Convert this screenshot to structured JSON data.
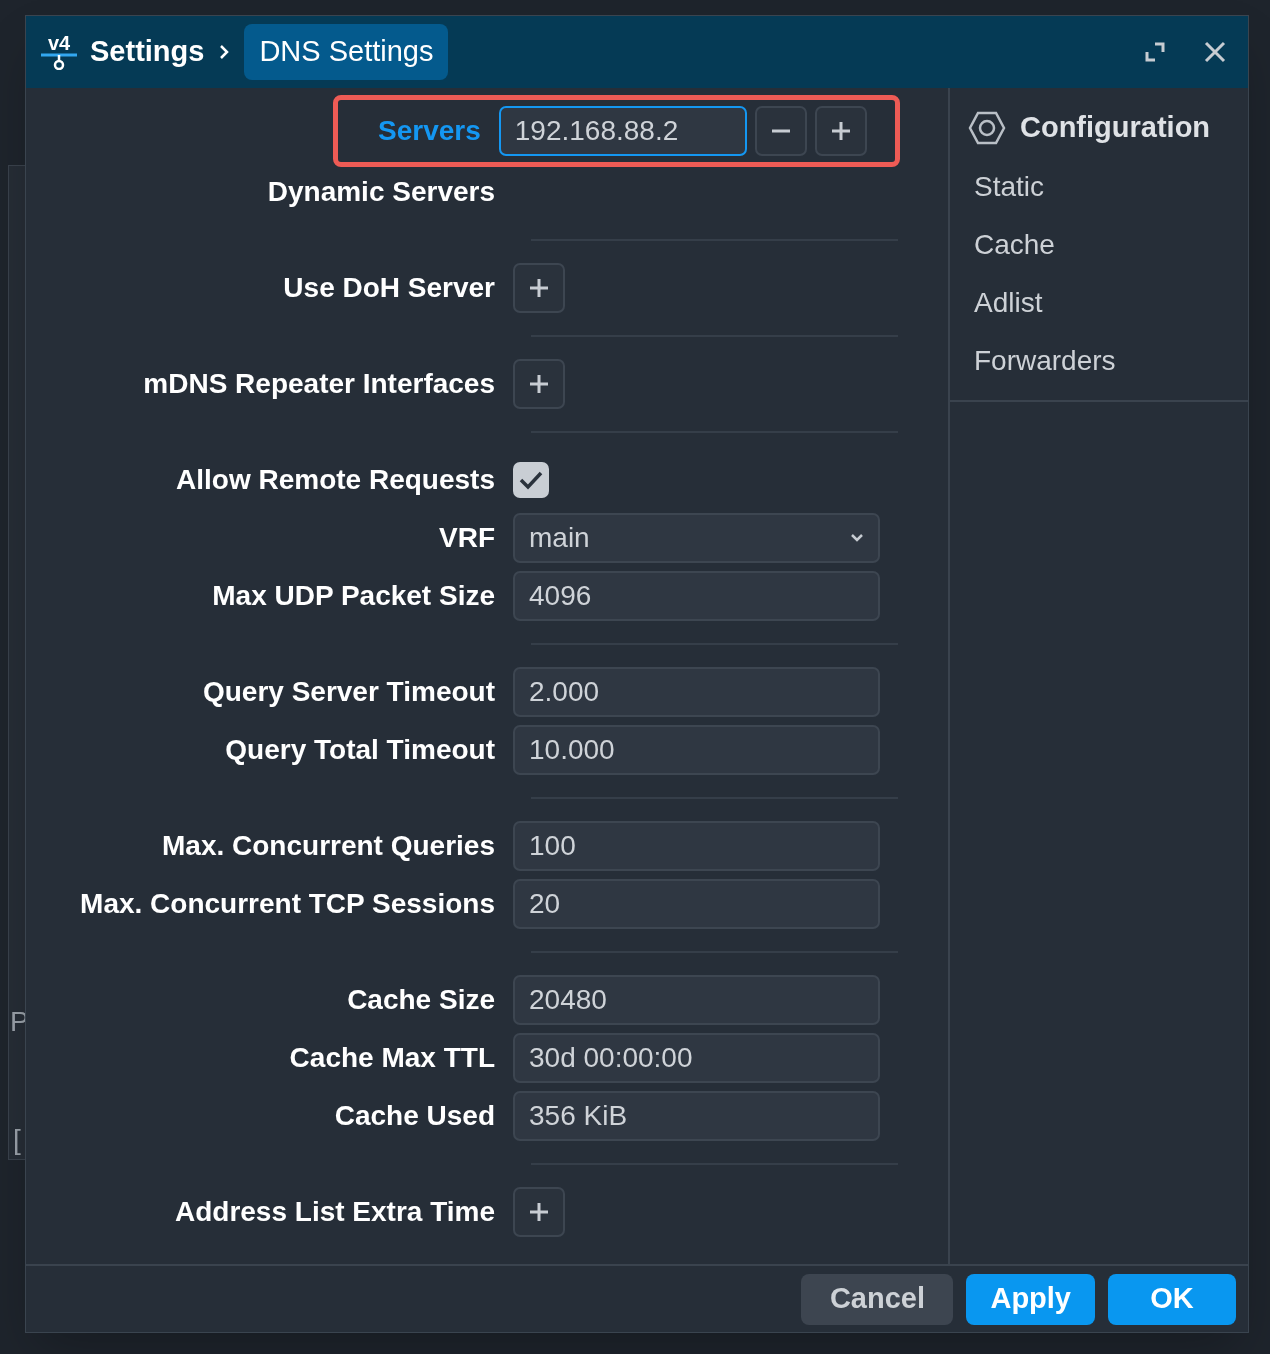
{
  "background_fragments": [
    "P",
    "["
  ],
  "window": {
    "logo_text": "v4",
    "breadcrumb": [
      {
        "label": "Settings",
        "selected": false
      },
      {
        "label": "DNS Settings",
        "selected": true
      }
    ]
  },
  "form": {
    "groups": [
      {
        "rows": [
          {
            "kind": "list_input",
            "label": "Servers",
            "value": "192.168.88.2",
            "focused": true,
            "highlighted": true
          },
          {
            "kind": "label",
            "label": "Dynamic Servers",
            "focused": false,
            "highlighted": false
          }
        ]
      },
      {
        "rows": [
          {
            "kind": "add",
            "label": "Use DoH Server",
            "focused": false,
            "highlighted": false
          }
        ]
      },
      {
        "rows": [
          {
            "kind": "add",
            "label": "mDNS Repeater Interfaces",
            "focused": false,
            "highlighted": false
          }
        ]
      },
      {
        "rows": [
          {
            "kind": "checkbox",
            "label": "Allow Remote Requests",
            "checked": true,
            "focused": false,
            "highlighted": false
          },
          {
            "kind": "select",
            "label": "VRF",
            "value": "main",
            "focused": false,
            "highlighted": false
          },
          {
            "kind": "input",
            "label": "Max UDP Packet Size",
            "value": "4096",
            "focused": false,
            "highlighted": false
          }
        ]
      },
      {
        "rows": [
          {
            "kind": "input",
            "label": "Query Server Timeout",
            "value": "2.000",
            "focused": false,
            "highlighted": false
          },
          {
            "kind": "input",
            "label": "Query Total Timeout",
            "value": "10.000",
            "focused": false,
            "highlighted": false
          }
        ]
      },
      {
        "rows": [
          {
            "kind": "input",
            "label": "Max. Concurrent Queries",
            "value": "100",
            "focused": false,
            "highlighted": false
          },
          {
            "kind": "input",
            "label": "Max. Concurrent TCP Sessions",
            "value": "20",
            "focused": false,
            "highlighted": false
          }
        ]
      },
      {
        "rows": [
          {
            "kind": "input",
            "label": "Cache Size",
            "value": "20480",
            "focused": false,
            "highlighted": false
          },
          {
            "kind": "input",
            "label": "Cache Max TTL",
            "value": "30d 00:00:00",
            "focused": false,
            "highlighted": false
          },
          {
            "kind": "input",
            "label": "Cache Used",
            "value": "356 KiB",
            "focused": false,
            "highlighted": false
          }
        ]
      },
      {
        "rows": [
          {
            "kind": "add",
            "label": "Address List Extra Time",
            "focused": false,
            "highlighted": false
          }
        ]
      }
    ]
  },
  "sidebar": {
    "heading": "Configuration",
    "items": [
      {
        "label": "Static",
        "selected": false
      },
      {
        "label": "Cache",
        "selected": false
      },
      {
        "label": "Adlist",
        "selected": false
      },
      {
        "label": "Forwarders",
        "selected": false
      }
    ]
  },
  "footer": {
    "buttons": [
      {
        "label": "Cancel",
        "kind": "secondary"
      },
      {
        "label": "Apply",
        "kind": "primary"
      },
      {
        "label": "OK",
        "kind": "primary"
      }
    ]
  }
}
